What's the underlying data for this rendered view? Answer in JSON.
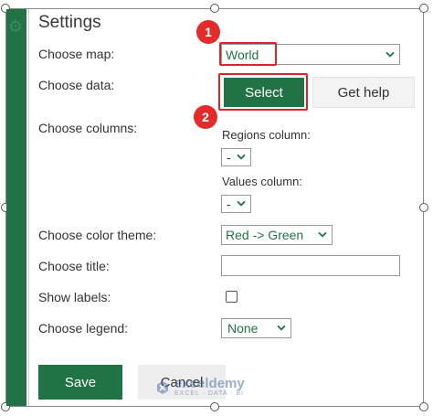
{
  "panel": {
    "title": "Settings",
    "labels": {
      "map": "Choose map:",
      "data": "Choose data:",
      "columns": "Choose columns:",
      "color_theme": "Choose color theme:",
      "title": "Choose title:",
      "show_labels": "Show labels:",
      "legend": "Choose legend:"
    },
    "map_select": {
      "value": "World"
    },
    "select_button": "Select",
    "help_button": "Get help",
    "regions_column": {
      "label": "Regions column:",
      "value": "-"
    },
    "values_column": {
      "label": "Values column:",
      "value": "-"
    },
    "color_theme_select": {
      "value": "Red -> Green"
    },
    "title_input": {
      "value": ""
    },
    "show_labels_checked": false,
    "legend_select": {
      "value": "None"
    },
    "save_button": "Save",
    "cancel_button": "Cancel"
  },
  "annotations": {
    "badge_1": "1",
    "badge_2": "2"
  },
  "watermark": {
    "name": "exceldemy",
    "tagline": "EXCEL · DATA · BI"
  },
  "colors": {
    "accent": "#217346",
    "highlight": "#e02424"
  }
}
